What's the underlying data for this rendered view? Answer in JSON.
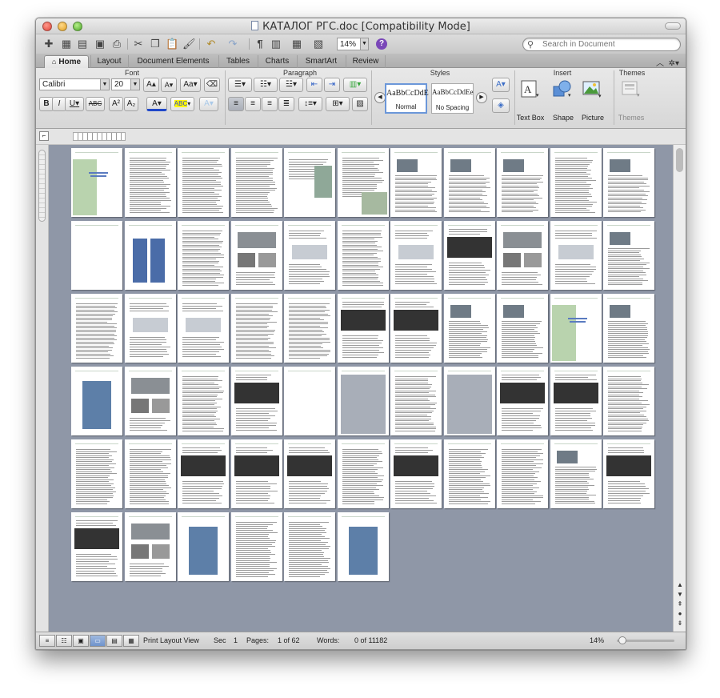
{
  "window": {
    "title": "КАТАЛОГ РГС.doc [Compatibility Mode]"
  },
  "toolbar": {
    "zoom": "14%",
    "search_placeholder": "Search in Document",
    "pilcrow": "¶",
    "help": "?"
  },
  "ribbon_tabs": [
    "Home",
    "Layout",
    "Document Elements",
    "Tables",
    "Charts",
    "SmartArt",
    "Review"
  ],
  "active_tab": "Home",
  "ribbon": {
    "groups": {
      "font": "Font",
      "paragraph": "Paragraph",
      "styles": "Styles",
      "insert": "Insert",
      "themes": "Themes"
    },
    "font_name": "Calibri",
    "font_size": "20",
    "grow_font": "A",
    "shrink_font": "A",
    "change_case": "Aa",
    "bold": "B",
    "italic": "I",
    "underline": "U",
    "strikethrough": "ABC",
    "superscript": "A²",
    "subscript": "A₂",
    "font_color_label": "A",
    "highlight_label": "ABC",
    "styles": [
      {
        "sample": "AaBbCcDdE",
        "name": "Normal"
      },
      {
        "sample": "AaBbCcDdEe",
        "name": "No Spacing"
      }
    ],
    "insert": [
      "Text Box",
      "Shape",
      "Picture"
    ],
    "themes_label": "Themes"
  },
  "statusbar": {
    "view": "Print Layout View",
    "sec_label": "Sec",
    "sec_value": "1",
    "pages_label": "Pages:",
    "pages_value": "1 of 62",
    "words_label": "Words:",
    "words_value": "0 of 11182",
    "zoom": "14%"
  },
  "pages": [
    "art",
    "text",
    "text",
    "text",
    "title-art",
    "text-art",
    "photo-text",
    "photo-text",
    "photo-text",
    "text",
    "photo-text",
    "blank",
    "machine",
    "text",
    "photos",
    "diagram",
    "text",
    "diagram",
    "table",
    "photos",
    "diagram",
    "photo-text",
    "text",
    "diagram",
    "diagram",
    "text",
    "text",
    "table",
    "table",
    "photo-text",
    "photo-text",
    "art",
    "photo-text",
    "photo",
    "photos",
    "text",
    "table",
    "blank",
    "map",
    "text",
    "map",
    "table",
    "table",
    "text",
    "text",
    "text",
    "table",
    "table",
    "table",
    "text",
    "table",
    "text",
    "text",
    "photo-text",
    "table",
    "table",
    "photos",
    "photo",
    "text",
    "text",
    "photo"
  ]
}
